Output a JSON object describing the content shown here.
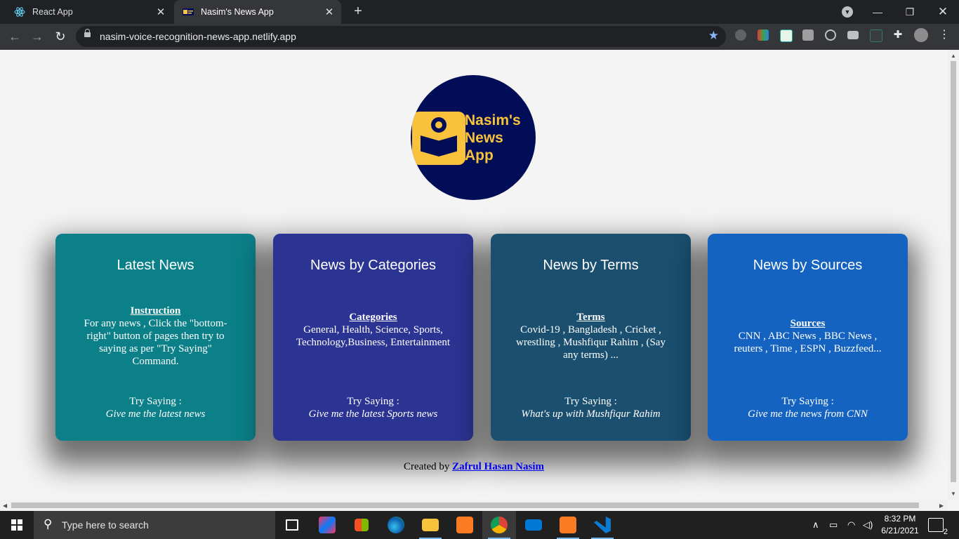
{
  "browser": {
    "tabs": [
      {
        "title": "React App",
        "active": false
      },
      {
        "title": "Nasim's News App",
        "active": true
      }
    ],
    "url": "nasim-voice-recognition-news-app.netlify.app"
  },
  "logo": {
    "line1": "Nasim's",
    "line2": "News",
    "line3": "App"
  },
  "cards": [
    {
      "title": "Latest News",
      "heading": "Instruction",
      "body": "For any news , Click the \"bottom-right\" button of pages then try to saying as per \"Try Saying\" Command.",
      "try_label": "Try Saying :",
      "try_text": "Give me the latest news",
      "color": "#0b8088"
    },
    {
      "title": "News by Categories",
      "heading": "Categories",
      "body": "General, Health, Science, Sports, Technology,Business, Entertainment",
      "try_label": "Try Saying :",
      "try_text": "Give me the latest Sports news",
      "color": "#2c3493"
    },
    {
      "title": "News by Terms",
      "heading": "Terms",
      "body": "Covid-19 , Bangladesh , Cricket , wrestling , Mushfiqur Rahim , (Say any terms) ...",
      "try_label": "Try Saying :",
      "try_text": "What's up with Mushfiqur Rahim",
      "color": "#1a4f70"
    },
    {
      "title": "News by Sources",
      "heading": "Sources",
      "body": "CNN , ABC News , BBC News , reuters , Time , ESPN , Buzzfeed...",
      "try_label": "Try Saying :",
      "try_text": "Give me the news from CNN",
      "color": "#1563c0"
    }
  ],
  "footer": {
    "prefix": "Created by",
    "author": "Zafrul Hasan Nasim"
  },
  "taskbar": {
    "search_placeholder": "Type here to search",
    "time": "8:32 PM",
    "date": "6/21/2021",
    "notifications": "2"
  }
}
